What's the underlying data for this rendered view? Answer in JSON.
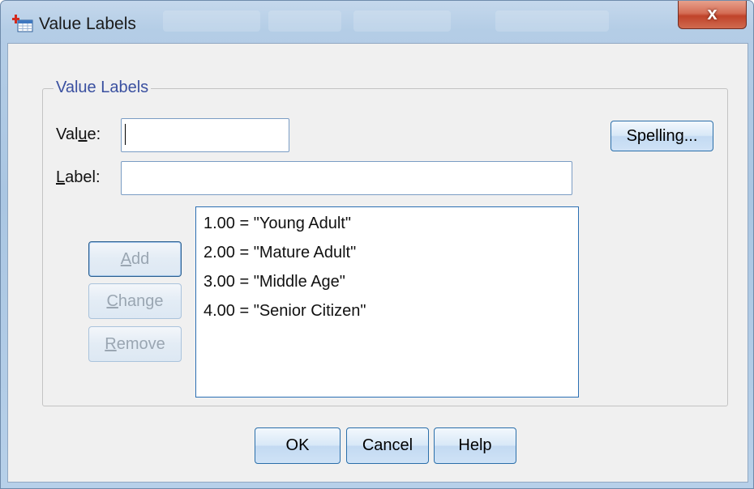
{
  "window": {
    "title": "Value Labels",
    "close_label": "x",
    "icon": "spss-data-icon"
  },
  "group": {
    "legend": "Value Labels"
  },
  "value_field": {
    "label_pre": "Val",
    "label_mnemonic": "u",
    "label_post": "e:",
    "value": ""
  },
  "label_field": {
    "label_mnemonic": "L",
    "label_post": "abel:",
    "value": ""
  },
  "buttons": {
    "spelling": "Spelling...",
    "add_mnemonic": "A",
    "add_post": "dd",
    "change_mnemonic": "C",
    "change_post": "hange",
    "remove_mnemonic": "R",
    "remove_post": "emove",
    "ok": "OK",
    "cancel": "Cancel",
    "help": "Help"
  },
  "value_list": [
    "1.00 = \"Young Adult\"",
    "2.00 = \"Mature Adult\"",
    "3.00 = \"Middle Age\"",
    "4.00 = \"Senior Citizen\""
  ],
  "colors": {
    "accent": "#2b6faa",
    "legend_text": "#3a50a0",
    "close_button": "#c0432a",
    "dialog_bg": "#f0f0f0"
  }
}
